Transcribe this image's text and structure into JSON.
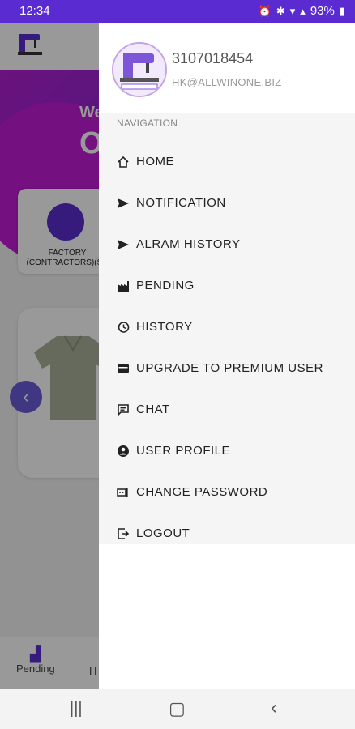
{
  "status_bar": {
    "time": "12:34",
    "battery": "93%"
  },
  "background_app": {
    "welcome": "We",
    "big_letter": "O",
    "card_label": "FACTORY (CONTRACTORS)(SU",
    "bottom_nav": [
      "Pending",
      "H"
    ]
  },
  "drawer": {
    "phone": "3107018454",
    "email": "HK@ALLWINONE.BIZ",
    "nav_label": "NAVIGATION",
    "items": [
      {
        "label": "HOME",
        "icon": "home-icon"
      },
      {
        "label": "NOTIFICATION",
        "icon": "send-icon"
      },
      {
        "label": "ALRAM HISTORY",
        "icon": "send-icon"
      },
      {
        "label": "PENDING",
        "icon": "factory-icon"
      },
      {
        "label": "HISTORY",
        "icon": "history-icon"
      },
      {
        "label": "UPGRADE TO PREMIUM USER",
        "icon": "card-icon"
      },
      {
        "label": "CHAT",
        "icon": "chat-icon"
      },
      {
        "label": "USER PROFILE",
        "icon": "account-icon"
      },
      {
        "label": "CHANGE PASSWORD",
        "icon": "password-icon"
      },
      {
        "label": "LOGOUT",
        "icon": "logout-icon"
      }
    ]
  },
  "colors": {
    "status_bar": "#5a2bd0",
    "accent": "#5b2dd1",
    "drawer_bg": "#f5f5f5"
  }
}
